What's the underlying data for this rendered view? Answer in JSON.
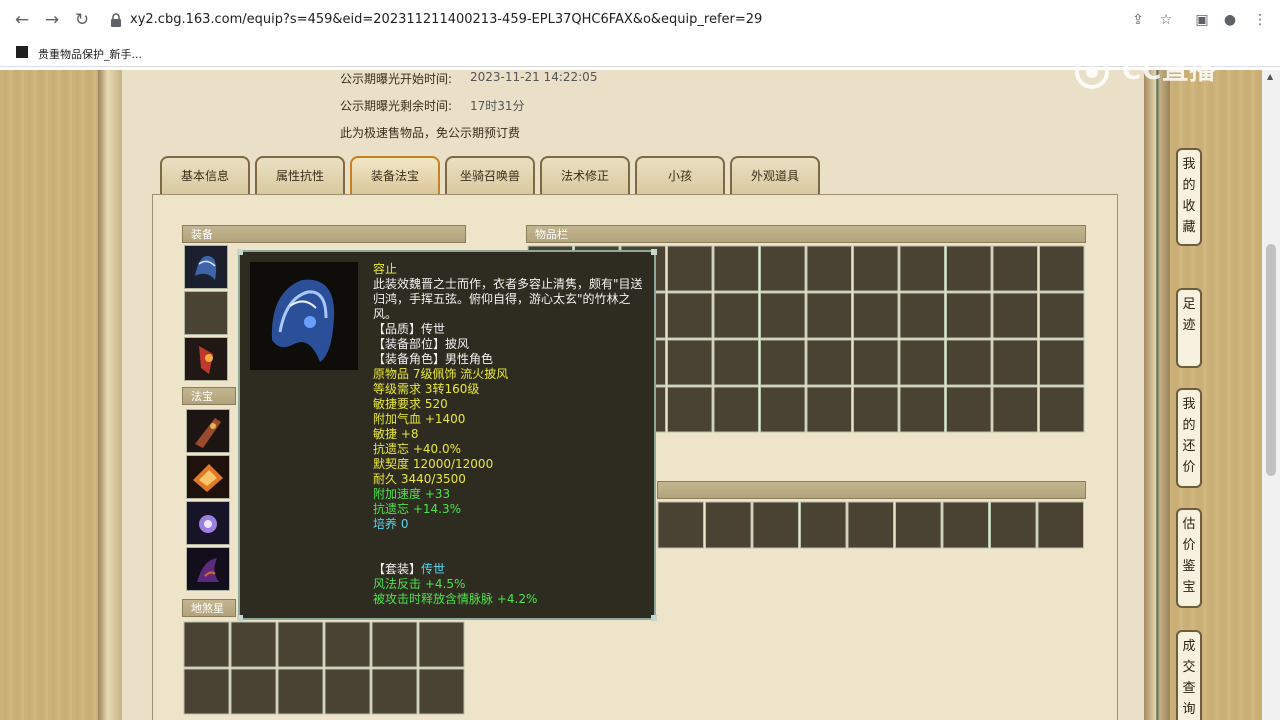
{
  "browser": {
    "url": "xy2.cbg.163.com/equip?s=459&eid=202311211400213-459-EPL37QHC6FAX&o&equip_refer=29",
    "bookmark_label": "贵重物品保护_新手..."
  },
  "info": {
    "start_label": "公示期曝光开始时间:",
    "start_value": "2023-11-21 14:22:05",
    "remain_label": "公示期曝光剩余时间:",
    "remain_value": "17时31分",
    "notice": "此为极速售物品，免公示期预订费"
  },
  "tabs": [
    {
      "label": "基本信息"
    },
    {
      "label": "属性抗性"
    },
    {
      "label": "装备法宝"
    },
    {
      "label": "坐骑召唤兽"
    },
    {
      "label": "法术修正"
    },
    {
      "label": "小孩"
    },
    {
      "label": "外观道具"
    }
  ],
  "active_tab": "装备法宝",
  "sections": {
    "equip": "装备",
    "fabao": "法宝",
    "disha": "地煞星",
    "inventory": "物品栏"
  },
  "tooltip": {
    "name": "容止",
    "description": [
      "此装效魏晋之士而作，衣者多容止清隽，颇有\"目送",
      "归鸿，手挥五弦。俯仰自得，游心太玄\"的竹林之",
      "风。"
    ],
    "quality": "【品质】传世",
    "slot": "【装备部位】披风",
    "role": "【装备角色】男性角色",
    "yellow_lines": [
      "原物品 7级佩饰 流火披风",
      "等级需求 3转160级",
      "敏捷要求 520",
      "附加气血 +1400",
      "敏捷 +8",
      "抗遗忘 +40.0%",
      "默契度 12000/12000",
      "耐久 3440/3500"
    ],
    "green_lines": [
      "附加速度 +33",
      "抗遗忘 +14.3%"
    ],
    "cyan_line": "培养 0",
    "set_prefix": "【套装】",
    "set_name": "传世",
    "set_lines": [
      "风法反击 +4.5%",
      "被攻击时释放含情脉脉 +4.2%"
    ]
  },
  "sidebar": [
    {
      "chars": [
        "我",
        "的",
        "收",
        "藏"
      ]
    },
    {
      "chars": [
        "足",
        "迹"
      ]
    },
    {
      "chars": [
        "我",
        "的",
        "还",
        "价"
      ]
    },
    {
      "chars": [
        "估",
        "价",
        "鉴",
        "宝"
      ]
    },
    {
      "chars": [
        "成",
        "交",
        "查",
        "询"
      ]
    }
  ],
  "watermark": "CC直播",
  "colors": {
    "tooltip_bg": "#2e2c21",
    "yellow": "#e8e838",
    "green": "#4ce24c",
    "cyan": "#56d6f0",
    "active_tab_border": "#c9801e"
  }
}
